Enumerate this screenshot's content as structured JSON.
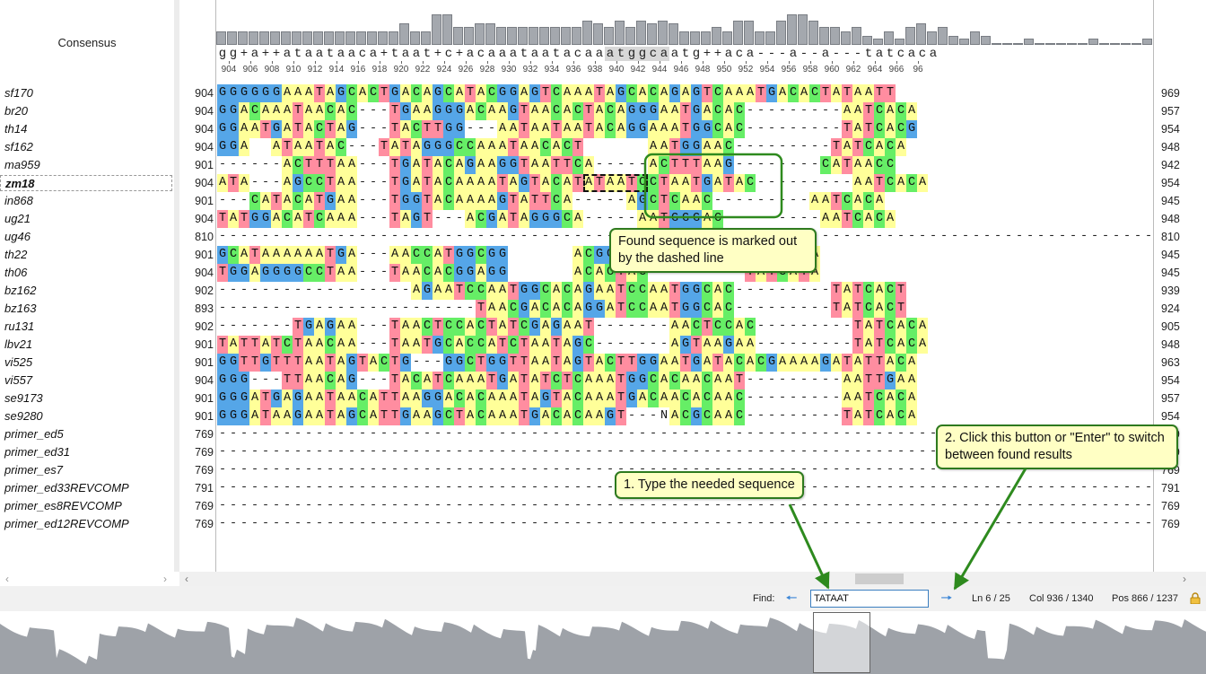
{
  "consensus_label": "Consensus",
  "consensus": "gg+a++ataataaca+taat+c+acaaataatacaaatggcaatg++aca---a--a---tatcaca",
  "consensus_highlight": [
    36,
    41
  ],
  "consensus_histogram": [
    9,
    9,
    9,
    9,
    9,
    9,
    9,
    9,
    9,
    9,
    9,
    9,
    9,
    9,
    9,
    9,
    9,
    14,
    9,
    9,
    20,
    20,
    12,
    12,
    14,
    14,
    12,
    12,
    12,
    12,
    12,
    12,
    12,
    12,
    16,
    14,
    12,
    16,
    12,
    16,
    14,
    16,
    14,
    9,
    9,
    9,
    12,
    9,
    16,
    16,
    9,
    9,
    16,
    20,
    20,
    16,
    12,
    12,
    9,
    12,
    6,
    4,
    9,
    4,
    12,
    14,
    9,
    12,
    6,
    4,
    9,
    6,
    1,
    1,
    1,
    4,
    1,
    1,
    1,
    1,
    1,
    4,
    1,
    1,
    1,
    1,
    4,
    4,
    1,
    1,
    9,
    9,
    16,
    20,
    20,
    20,
    20,
    16,
    20
  ],
  "ruler_labels": [
    "904",
    "906",
    "908",
    "910",
    "912",
    "914",
    "916",
    "918",
    "920",
    "922",
    "924",
    "926",
    "928",
    "930",
    "932",
    "934",
    "936",
    "938",
    "940",
    "942",
    "944",
    "946",
    "948",
    "950",
    "952",
    "954",
    "956",
    "958",
    "960",
    "962",
    "964",
    "966",
    "96"
  ],
  "sequences": [
    {
      "name": "sf170",
      "start": "904",
      "end": "969",
      "residues": "GGGGGGAAATAGCACTGACAGCATACGGAGTCAAATAGCACAGAGTCAAATGACACTATAATT"
    },
    {
      "name": "br20",
      "start": "904",
      "end": "957",
      "residues": "GGACAAATAACAC---TGAAGGGACAAGTAACACTACAGGGAATGACAC---------AATCACA"
    },
    {
      "name": "th14",
      "start": "904",
      "end": "954",
      "residues": "GGAATGATACTAG---TACTTGG---AATAATAATACAGGAAATGGCAC---------TATCACG"
    },
    {
      "name": "sf162",
      "start": "904",
      "end": "948",
      "residues": "GGA  ATAATAC---TATAGGGCCAAATAACACT      AATGGAAC---------TATCACA"
    },
    {
      "name": "ma959",
      "start": "901",
      "end": "942",
      "residues": "------ACTTTAA---TGATACAGAAGGTAATTCA-----ACTTTAAG--------CATAACC"
    },
    {
      "name": "zm18",
      "start": "904",
      "end": "954",
      "residues": "ATA---AGCCTAA---TGATACAAAATAGTACATATAATCCTAATGATAC---------AATCACA"
    },
    {
      "name": "in868",
      "start": "901",
      "end": "945",
      "residues": "---CATACATGAA---TGGTACAAAAGTATTCA-----AGCTCAAC---------AATCACA"
    },
    {
      "name": "ug21",
      "start": "904",
      "end": "948",
      "residues": "TATGGACATCAAA---TAGT---ACGATAGGGCA-----AATGGGAC---------AATCACA"
    },
    {
      "name": "ug46",
      "start": "810",
      "end": "810",
      "residues": "---------------------------------------------------------------------------------------------------------------------------------------------------------------------------------------------------------------------------------"
    },
    {
      "name": "th22",
      "start": "901",
      "end": "945",
      "residues": "GCATAAAAAATGA---AACCATGGCGG      ACGGCAC---------TATCATA"
    },
    {
      "name": "th06",
      "start": "904",
      "end": "945",
      "residues": "TGGAGGGGCCTAA---TAACACGGAGG      ACACTAC---------TATCATA"
    },
    {
      "name": "bz162",
      "start": "902",
      "end": "939",
      "residues": "------------------AGAATCCAATGGCACAGAATCCAATGGCAC---------TATCACT"
    },
    {
      "name": "bz163",
      "start": "893",
      "end": "924",
      "residues": "------------------------TAACGACACAGGATCCAATGGCAC---------TATCACT"
    },
    {
      "name": "ru131",
      "start": "902",
      "end": "905",
      "residues": "-------TGAGAA---TAACTCCACTATCGAGAAT-------AACTCCAC---------TATCACA"
    },
    {
      "name": "lbv21",
      "start": "901",
      "end": "948",
      "residues": "TATTATCTAACAA---TAATGCACCATCTAATAGC-------AGTAAGAA---------TATCACA"
    },
    {
      "name": "vi525",
      "start": "901",
      "end": "963",
      "residues": "GGTTGTTTAATAGTACTG---GGCTGGTTAATAGTACTTGGAATGATACACGAAAAGATATTACA"
    },
    {
      "name": "vi557",
      "start": "904",
      "end": "954",
      "residues": "GGG---TTAACAG---TACATCAAATGATATCTCAAATGGCACAACAAT---------AATTGAA"
    },
    {
      "name": "se9173",
      "start": "901",
      "end": "957",
      "residues": "GGGATGAGAATAACATTAAGGACACAAATAGTACAAATGACAACACAAC---------AATCACA"
    },
    {
      "name": "se9280",
      "start": "901",
      "end": "954",
      "residues": "GGGATAAGAATAGCATTGAAGCTACAAATGACACAAGT---NACGCAAC---------TATCACA"
    },
    {
      "name": "primer_ed5",
      "start": "769",
      "end": "769",
      "residues": "-----------------------------------------------------------------------------------------------------"
    },
    {
      "name": "primer_ed31",
      "start": "769",
      "end": "769",
      "residues": "-----------------------------------------------------------------------------------------------------"
    },
    {
      "name": "primer_es7",
      "start": "769",
      "end": "769",
      "residues": "-----------------------------------------------------------------------------------------------------"
    },
    {
      "name": "primer_ed33REVCOMP",
      "start": "791",
      "end": "791",
      "residues": "-----------------------------------------------------------------------------------------------------"
    },
    {
      "name": "primer_es8REVCOMP",
      "start": "769",
      "end": "769",
      "residues": "-----------------------------------------------------------------------------------------------------"
    },
    {
      "name": "primer_ed12REVCOMP",
      "start": "769",
      "end": "769",
      "residues": "-----------------------------------------------------------------------------------------------------"
    }
  ],
  "selected_sequence": "zm18",
  "found_match": {
    "row": 5,
    "from": 34,
    "to": 39
  },
  "colors": {
    "A": "#ffff99",
    "C": "#66ee66",
    "G": "#55a6e8",
    "T": "#ff8da0",
    "N": "#ffffff",
    "callout_border": "#2e7a1e",
    "callout_bg": "#ffffc4",
    "arrow": "#2e8a1e"
  },
  "find": {
    "label": "Find:",
    "value": "TATAAT"
  },
  "status": {
    "line": "Ln 6 / 25",
    "column": "Col 936 / 1340",
    "position": "Pos 866 / 1237"
  },
  "icons": {
    "find_prev": "left-arrow-icon",
    "find_next": "right-arrow-icon",
    "lock": "lock-icon",
    "scroll_left": "chevron-left-icon",
    "scroll_right": "chevron-right-icon"
  },
  "callouts": {
    "found": "Found sequence is marked out by the dashed line",
    "type": "1. Type the needed sequence",
    "click": "2. Click this button or \"Enter\" to switch between found results"
  }
}
